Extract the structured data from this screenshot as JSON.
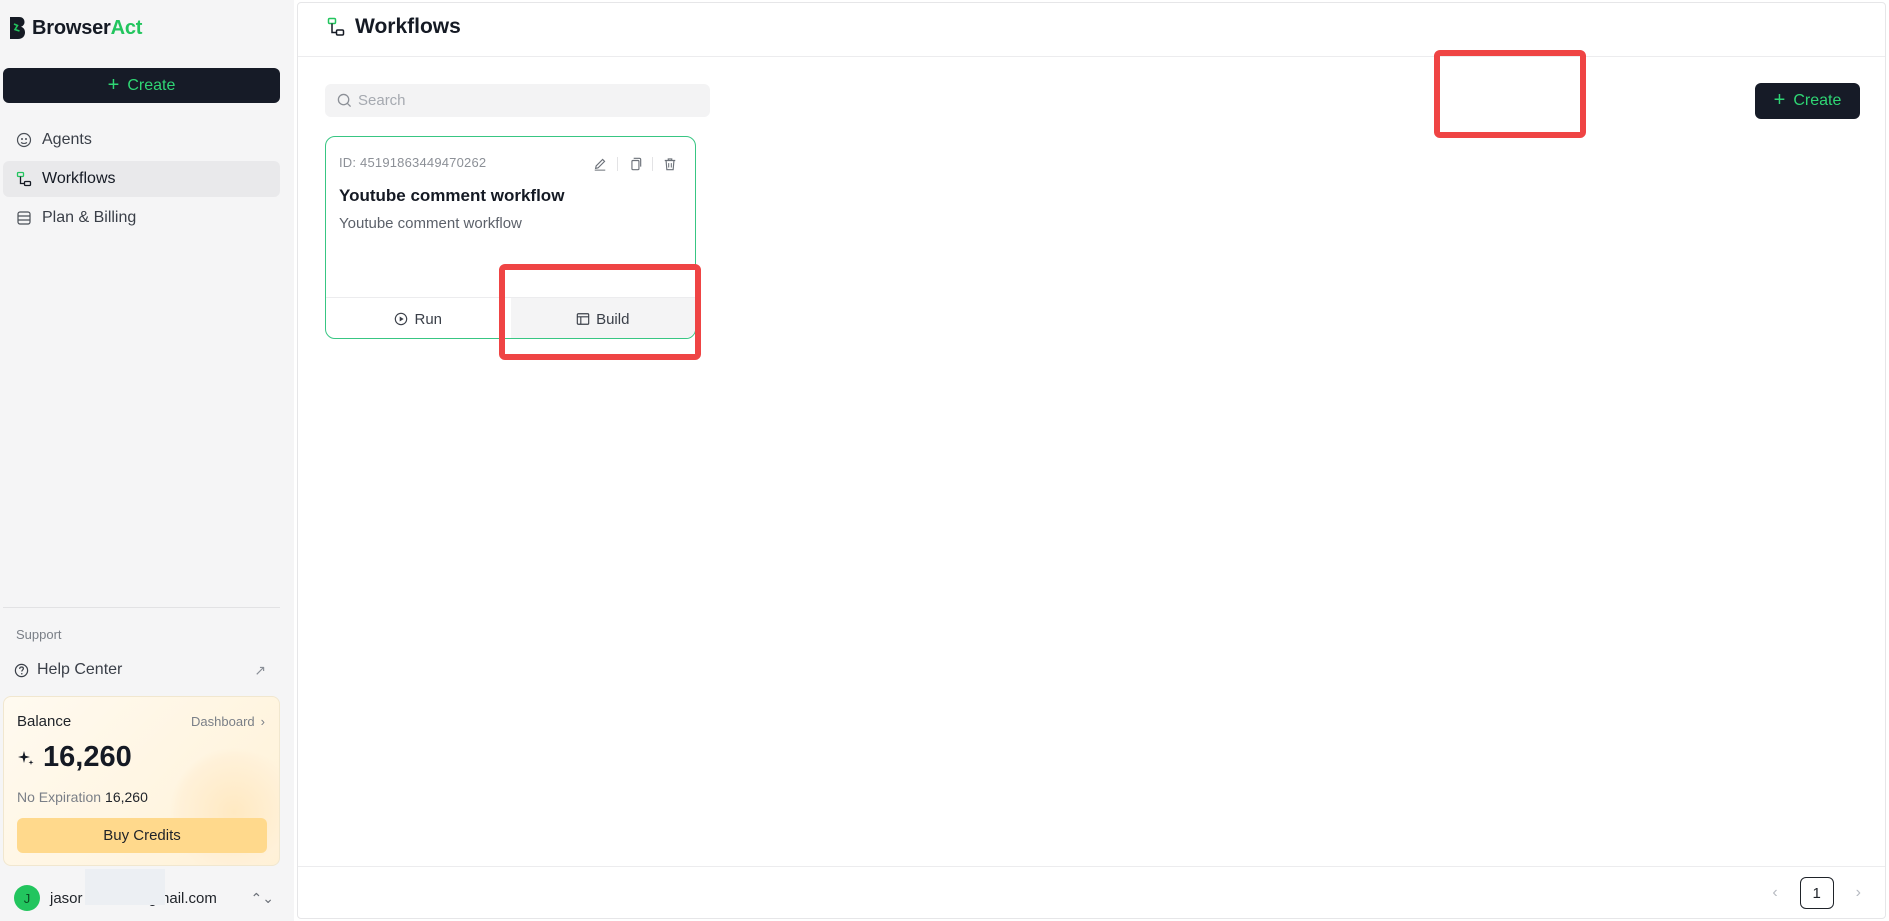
{
  "brand": {
    "name_part1": "Browser",
    "name_part2": "Act",
    "accent_color": "#22c55e"
  },
  "sidebar": {
    "create_label": "Create",
    "items": [
      {
        "label": "Agents",
        "icon": "agent-icon"
      },
      {
        "label": "Workflows",
        "icon": "workflow-icon",
        "active": true
      },
      {
        "label": "Plan & Billing",
        "icon": "billing-icon"
      }
    ],
    "support_label": "Support",
    "help_center_label": "Help Center"
  },
  "balance": {
    "title": "Balance",
    "dashboard_label": "Dashboard",
    "amount": "16,260",
    "expiration_label": "No Expiration",
    "expiration_amount": "16,260",
    "buy_label": "Buy Credits"
  },
  "user": {
    "initial": "J",
    "email_start": "jasor",
    "email_end": "gmail.com"
  },
  "main": {
    "title": "Workflows",
    "search_placeholder": "Search",
    "create_label": "Create"
  },
  "workflows": [
    {
      "id": "ID: 45191863449470262",
      "name": "Youtube comment workflow",
      "description": "Youtube comment workflow",
      "run_label": "Run",
      "build_label": "Build"
    }
  ],
  "pagination": {
    "current_page": "1"
  },
  "highlight_color": "#ef4444"
}
